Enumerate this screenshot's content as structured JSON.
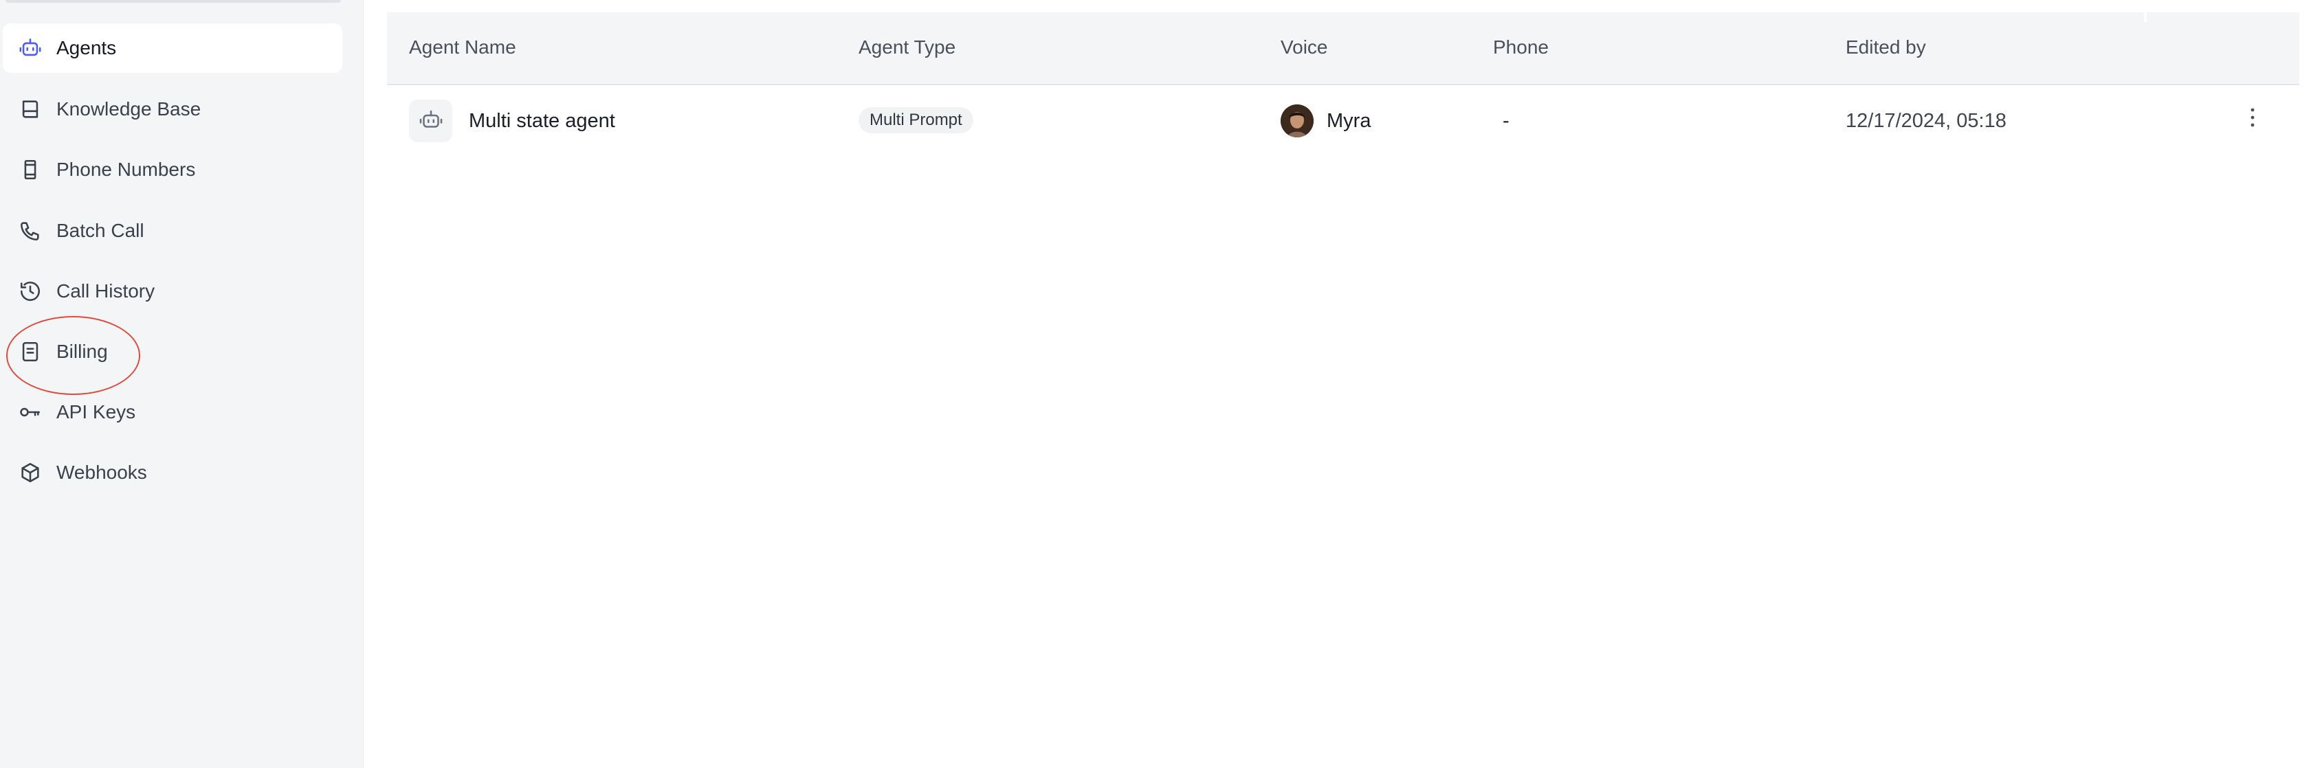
{
  "sidebar": {
    "items": [
      {
        "label": "Agents",
        "icon": "bot-icon",
        "active": true
      },
      {
        "label": "Knowledge Base",
        "icon": "book-icon",
        "active": false
      },
      {
        "label": "Phone Numbers",
        "icon": "phone-device-icon",
        "active": false
      },
      {
        "label": "Batch Call",
        "icon": "phone-icon",
        "active": false
      },
      {
        "label": "Call History",
        "icon": "history-icon",
        "active": false
      },
      {
        "label": "Billing",
        "icon": "receipt-icon",
        "active": false
      },
      {
        "label": "API Keys",
        "icon": "key-icon",
        "active": false
      },
      {
        "label": "Webhooks",
        "icon": "box-icon",
        "active": false
      }
    ]
  },
  "table": {
    "columns": [
      "Agent Name",
      "Agent Type",
      "Voice",
      "Phone",
      "Edited by"
    ],
    "rows": [
      {
        "agent_name": "Multi state agent",
        "agent_type": "Multi Prompt",
        "voice": "Myra",
        "phone": "-",
        "edited_by": "12/17/2024, 05:18"
      }
    ]
  },
  "colors": {
    "accent": "#4b5df2",
    "annotation": "#e04b3b",
    "sidebar_bg": "#f4f5f7",
    "header_bg": "#f4f5f7"
  }
}
